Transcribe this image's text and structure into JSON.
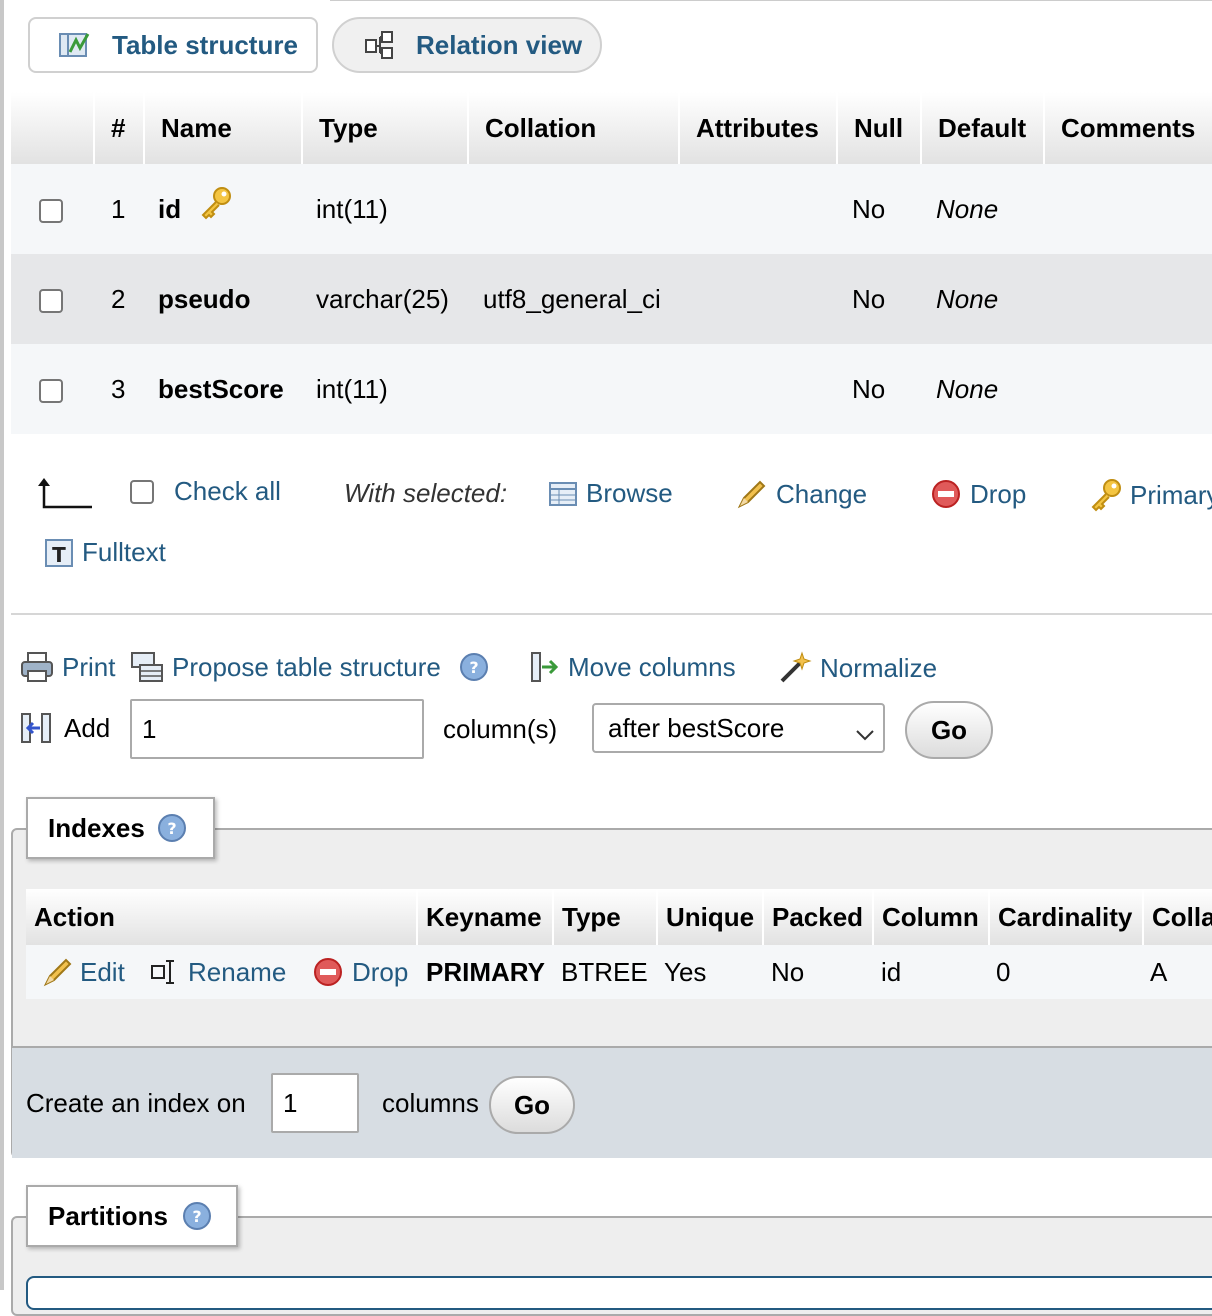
{
  "tabs": [
    {
      "label": "Table structure",
      "icon": "table-structure-icon"
    },
    {
      "label": "Relation view",
      "icon": "relation-view-icon"
    }
  ],
  "structure": {
    "headers": [
      "#",
      "Name",
      "Type",
      "Collation",
      "Attributes",
      "Null",
      "Default",
      "Comments"
    ],
    "rows": [
      {
        "num": "1",
        "name": "id",
        "type": "int(11)",
        "collation": "",
        "attributes": "",
        "null": "No",
        "default": "None",
        "primary_key": true
      },
      {
        "num": "2",
        "name": "pseudo",
        "type": "varchar(25)",
        "collation": "utf8_general_ci",
        "attributes": "",
        "null": "No",
        "default": "None"
      },
      {
        "num": "3",
        "name": "bestScore",
        "type": "int(11)",
        "collation": "",
        "attributes": "",
        "null": "No",
        "default": "None"
      }
    ]
  },
  "bulk_actions": {
    "check_all": "Check all",
    "with_selected": "With selected:",
    "browse": "Browse",
    "change": "Change",
    "drop": "Drop",
    "primary": "Primary",
    "fulltext": "Fulltext"
  },
  "tools": {
    "print": "Print",
    "propose": "Propose table structure",
    "move_columns": "Move columns",
    "normalize": "Normalize"
  },
  "add_column": {
    "label": "Add",
    "value": "1",
    "suffix": "column(s)",
    "position": "after bestScore",
    "go": "Go"
  },
  "indexes": {
    "legend": "Indexes",
    "headers": [
      "Action",
      "Keyname",
      "Type",
      "Unique",
      "Packed",
      "Column",
      "Cardinality",
      "Colla"
    ],
    "row": {
      "edit": "Edit",
      "rename": "Rename",
      "drop": "Drop",
      "keyname": "PRIMARY",
      "type": "BTREE",
      "unique": "Yes",
      "packed": "No",
      "column": "id",
      "cardinality": "0",
      "collation": "A"
    },
    "create": {
      "label": "Create an index on",
      "value": "1",
      "suffix": "columns",
      "go": "Go"
    }
  },
  "partitions": {
    "legend": "Partitions"
  },
  "colors": {
    "link": "#235a81",
    "row_odd": "#f5f7f9",
    "row_even": "#e6e7e9"
  }
}
